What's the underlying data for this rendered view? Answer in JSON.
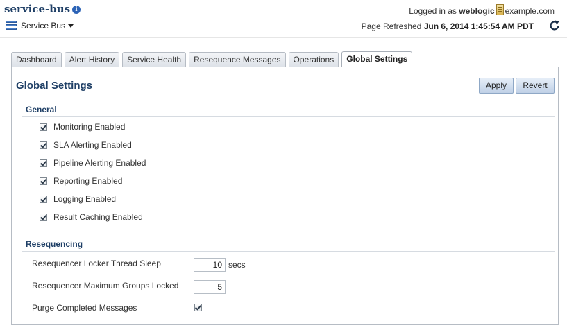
{
  "header": {
    "app_title": "service-bus",
    "info_icon": "i",
    "login_prefix": "Logged in as",
    "login_user": "weblogic",
    "login_host": "example.com",
    "menu_label": "Service Bus",
    "refresh_prefix": "Page Refreshed",
    "refresh_time": "Jun 6, 2014 1:45:54 AM PDT"
  },
  "tabs": [
    {
      "label": "Dashboard",
      "active": false
    },
    {
      "label": "Alert History",
      "active": false
    },
    {
      "label": "Service Health",
      "active": false
    },
    {
      "label": "Resequence Messages",
      "active": false
    },
    {
      "label": "Operations",
      "active": false
    },
    {
      "label": "Global Settings",
      "active": true
    }
  ],
  "panel": {
    "title": "Global Settings",
    "apply_label": "Apply",
    "revert_label": "Revert"
  },
  "general": {
    "title": "General",
    "options": [
      {
        "label": "Monitoring Enabled",
        "checked": true
      },
      {
        "label": "SLA Alerting Enabled",
        "checked": true
      },
      {
        "label": "Pipeline Alerting Enabled",
        "checked": true
      },
      {
        "label": "Reporting Enabled",
        "checked": true
      },
      {
        "label": "Logging Enabled",
        "checked": true
      },
      {
        "label": "Result Caching Enabled",
        "checked": true
      }
    ]
  },
  "resequencing": {
    "title": "Resequencing",
    "thread_sleep_label": "Resequencer Locker Thread Sleep",
    "thread_sleep_value": "10",
    "thread_sleep_unit": "secs",
    "max_groups_label": "Resequencer Maximum Groups Locked",
    "max_groups_value": "5",
    "purge_label": "Purge Completed Messages",
    "purge_checked": true
  },
  "icons": {
    "info": "info-icon",
    "server": "server-icon",
    "menu": "service-bus-menu-icon",
    "refresh": "refresh-icon"
  },
  "colors": {
    "title_blue": "#1f3f66",
    "button_bg": "#bfd0e6",
    "tab_border": "#b6bcc4"
  }
}
